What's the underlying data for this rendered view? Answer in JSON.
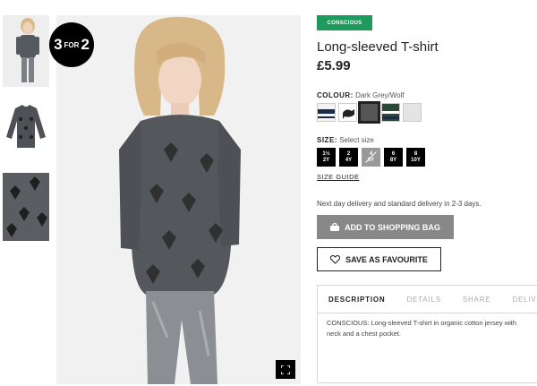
{
  "promo": {
    "big_left": "3",
    "small": "FOR",
    "big_right": "2"
  },
  "product": {
    "badge": "CONSCIOUS",
    "title": "Long-sleeved T-shirt",
    "price": "£5.99"
  },
  "colour": {
    "label": "COLOUR:",
    "selected": "Dark Grey/Wolf",
    "swatches": [
      {
        "name": "navy-stripe",
        "color": "#1c2a48"
      },
      {
        "name": "animal-print",
        "color": "#ffffff"
      },
      {
        "name": "dark-grey-wolf",
        "color": "#555555",
        "selected": true
      },
      {
        "name": "green-stripe",
        "color": "#2c4a33"
      },
      {
        "name": "light-grey",
        "color": "#e4e4e4"
      }
    ]
  },
  "size": {
    "label": "SIZE:",
    "placeholder": "Select size",
    "options": [
      {
        "top": "1½",
        "bottom": "2Y",
        "available": true
      },
      {
        "top": "2",
        "bottom": "4Y",
        "available": true
      },
      {
        "top": "4",
        "bottom": "6Y",
        "available": false
      },
      {
        "top": "6",
        "bottom": "8Y",
        "available": true
      },
      {
        "top": "8",
        "bottom": "10Y",
        "available": true
      }
    ],
    "guide": "SIZE GUIDE"
  },
  "delivery": "Next day delivery and standard delivery in 2-3 days.",
  "actions": {
    "add_to_bag": "ADD TO SHOPPING BAG",
    "save_favourite": "SAVE AS FAVOURITE"
  },
  "tabs": [
    "DESCRIPTION",
    "DETAILS",
    "SHARE",
    "DELIVERY"
  ],
  "description": {
    "line1": "CONSCIOUS: Long-sleeved T-shirt in organic cotton jersey with",
    "line2": "neck and a chest pocket."
  },
  "colors": {
    "conscious_green": "#1d9a5c",
    "button_grey": "#888888"
  }
}
